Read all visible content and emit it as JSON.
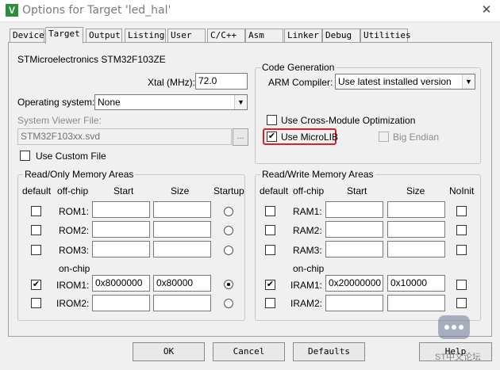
{
  "window": {
    "app_icon_text": "V",
    "title": "Options for Target 'led_hal'",
    "close_glyph": "✕"
  },
  "tabs": [
    {
      "label": "Device"
    },
    {
      "label": "Target"
    },
    {
      "label": "Output"
    },
    {
      "label": "Listing"
    },
    {
      "label": "User"
    },
    {
      "label": "C/C++"
    },
    {
      "label": "Asm"
    },
    {
      "label": "Linker"
    },
    {
      "label": "Debug"
    },
    {
      "label": "Utilities"
    }
  ],
  "target": {
    "device_name": "STMicroelectronics STM32F103ZE",
    "xtal_label": "Xtal (MHz):",
    "xtal_value": "72.0",
    "os_label": "Operating system:",
    "os_value": "None",
    "svf_label": "System Viewer File:",
    "svf_value": "STM32F103xx.svd",
    "browse_label": "...",
    "custom_file_label": "Use Custom File"
  },
  "code_generation": {
    "title": "Code Generation",
    "compiler_label": "ARM Compiler:",
    "compiler_value": "Use latest installed version",
    "cross_module_label": "Use Cross-Module Optimization",
    "microlib_label": "Use MicroLIB",
    "big_endian_label": "Big Endian",
    "check_glyph": "✔"
  },
  "ro_memory": {
    "title": "Read/Only Memory Areas",
    "headers": {
      "default": "default",
      "offchip": "off-chip",
      "start": "Start",
      "size": "Size",
      "startup": "Startup"
    },
    "onchip_label": "on-chip",
    "rows": [
      {
        "name": "ROM1:",
        "start": "",
        "size": ""
      },
      {
        "name": "ROM2:",
        "start": "",
        "size": ""
      },
      {
        "name": "ROM3:",
        "start": "",
        "size": ""
      },
      {
        "name": "IROM1:",
        "start": "0x8000000",
        "size": "0x80000"
      },
      {
        "name": "IROM2:",
        "start": "",
        "size": ""
      }
    ]
  },
  "rw_memory": {
    "title": "Read/Write Memory Areas",
    "headers": {
      "default": "default",
      "offchip": "off-chip",
      "start": "Start",
      "size": "Size",
      "noinit": "NoInit"
    },
    "onchip_label": "on-chip",
    "rows": [
      {
        "name": "RAM1:",
        "start": "",
        "size": ""
      },
      {
        "name": "RAM2:",
        "start": "",
        "size": ""
      },
      {
        "name": "RAM3:",
        "start": "",
        "size": ""
      },
      {
        "name": "IRAM1:",
        "start": "0x20000000",
        "size": "0x10000"
      },
      {
        "name": "IRAM2:",
        "start": "",
        "size": ""
      }
    ]
  },
  "buttons": {
    "ok": "OK",
    "cancel": "Cancel",
    "defaults": "Defaults",
    "help": "Help"
  },
  "watermark": {
    "text": "ST中文论坛"
  }
}
